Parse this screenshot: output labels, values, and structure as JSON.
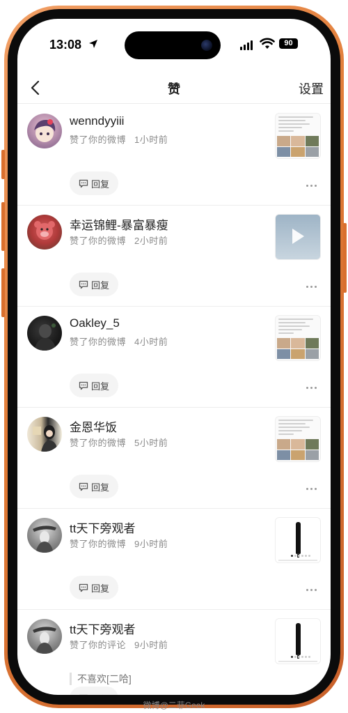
{
  "status_bar": {
    "time": "13:08",
    "battery": "90"
  },
  "nav": {
    "title": "赞",
    "settings_label": "设置"
  },
  "items": [
    {
      "name": "wenndyyiii",
      "action": "赞了你的微博",
      "time": "1小时前",
      "reply_label": "回复",
      "thumb": "text-grid"
    },
    {
      "name": "幸运锦鲤-暴富暴瘦",
      "action": "赞了你的微博",
      "time": "2小时前",
      "reply_label": "回复",
      "thumb": "video"
    },
    {
      "name": "Oakley_5",
      "action": "赞了你的微博",
      "time": "4小时前",
      "reply_label": "回复",
      "thumb": "text-grid"
    },
    {
      "name": "金恩华饭",
      "action": "赞了你的微博",
      "time": "5小时前",
      "reply_label": "回复",
      "thumb": "text-grid"
    },
    {
      "name": "tt天下旁观者",
      "action": "赞了你的微博",
      "time": "9小时前",
      "reply_label": "回复",
      "thumb": "product"
    },
    {
      "name": "tt天下旁观者",
      "action": "赞了你的评论",
      "time": "9小时前",
      "comment": "不喜欢[二哈]",
      "reply_label": "回复",
      "thumb": "product"
    }
  ],
  "watermark": "微博@二菲Geek",
  "colors": {
    "frame": "#e07a35",
    "text_primary": "#222222",
    "text_secondary": "#8a8a8a",
    "reply_bg": "#f4f4f4"
  },
  "icons": [
    "location-arrow-icon",
    "signal-icon",
    "wifi-icon",
    "battery-icon",
    "back-chevron-icon",
    "comment-bubble-icon",
    "more-dots-icon",
    "play-icon"
  ]
}
